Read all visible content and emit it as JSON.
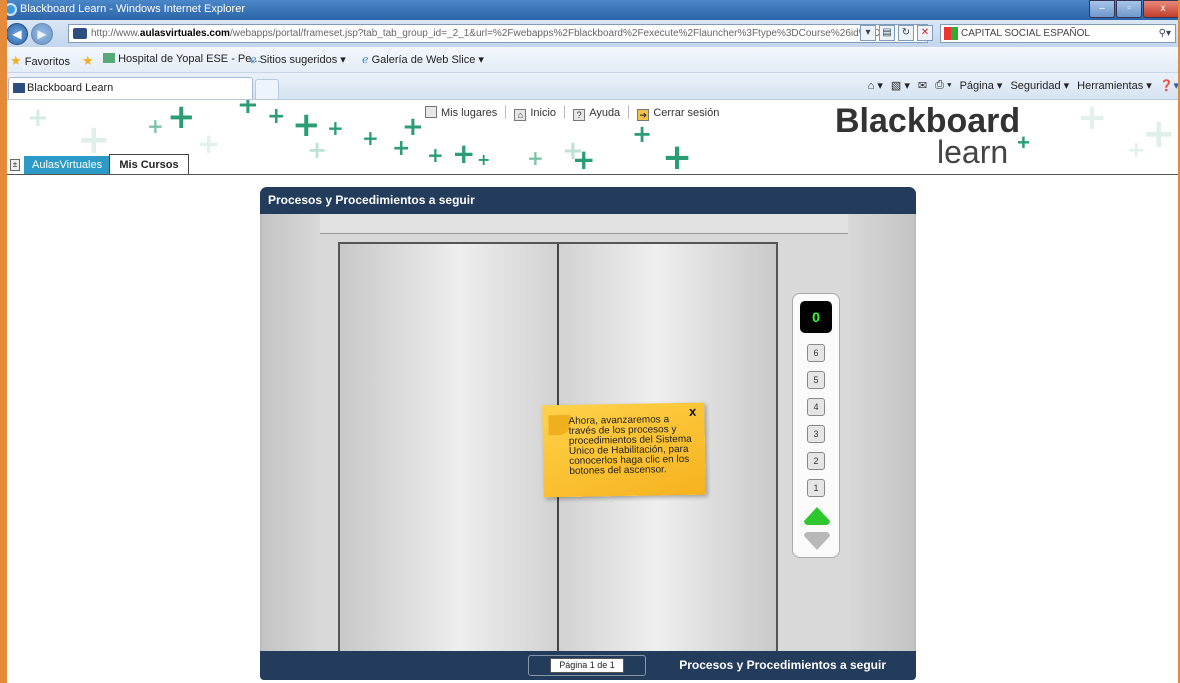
{
  "window": {
    "title": "Blackboard Learn - Windows Internet Explorer",
    "minimize": "–",
    "maximize": "▫",
    "close": "x"
  },
  "address_bar": {
    "url_prefix": "http://www.",
    "url_domain": "aulasvirtuales.com",
    "url_rest": "/webapps/portal/frameset.jsp?tab_tab_group_id=_2_1&url=%2Fwebapps%2Fblackboard%2Fexecute%2Flauncher%3Ftype%3DCourse%26id%3D_1",
    "search_text": "CAPITAL SOCIAL ESPAÑOL"
  },
  "favorites_bar": {
    "favorites": "Favoritos",
    "item1": "Hospital de Yopal ESE - Pe...",
    "item2": "Sitios sugeridos ▾",
    "item3": "Galería de Web Slice ▾"
  },
  "tab_bar": {
    "tab_title": "Blackboard Learn",
    "commands": [
      "Página ▾",
      "Seguridad ▾",
      "Herramientas ▾"
    ]
  },
  "bb_header": {
    "links": [
      "Mis lugares",
      "Inicio",
      "Ayuda",
      "Cerrar sesión"
    ],
    "logo_top": "Blackboard",
    "logo_bottom": "learn",
    "tabs": [
      "AulasVirtuales",
      "Mis Cursos"
    ]
  },
  "module": {
    "title": "Procesos y Procedimientos a seguir",
    "footer_title": "Procesos y Procedimientos a seguir",
    "pager": "Página 1 de 1"
  },
  "elevator": {
    "current_floor": "0",
    "floors": [
      "6",
      "5",
      "4",
      "3",
      "2",
      "1"
    ],
    "up_color": "#2ec82e",
    "down_color": "#b8b8b8"
  },
  "note": {
    "text": "Ahora, avanzaremos a través de los procesos y procedimientos del Sistema Unico de Habilitación, para conocerlos haga clic en los botones del ascensor.",
    "close": "x"
  },
  "colors": {
    "frame_border": "#e48b3a",
    "module_header": "#243c5c",
    "brand_green": "#2a9d74",
    "tab_blue": "#2c9ac7"
  }
}
